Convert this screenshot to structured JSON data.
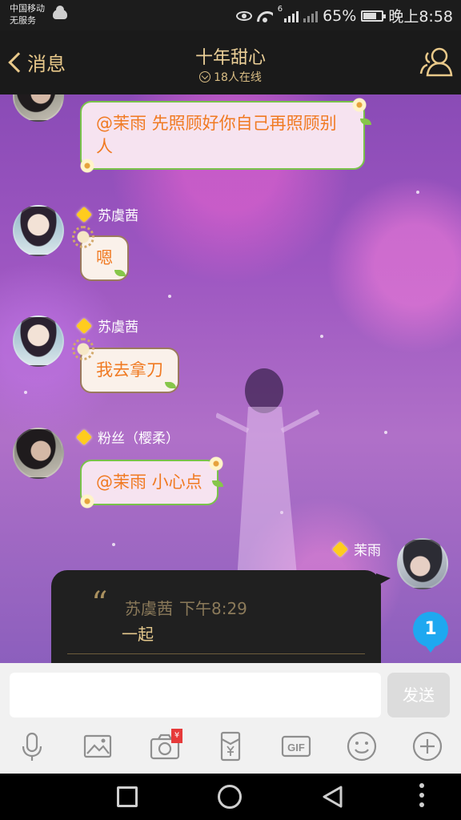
{
  "status_bar": {
    "carrier_line1": "中国移动",
    "carrier_line2": "无服务",
    "network_type": "6",
    "battery": "65%",
    "time": "晚上8:58"
  },
  "header": {
    "back_label": "消息",
    "title": "十年甜心",
    "online_count": "18人在线"
  },
  "messages": [
    {
      "sender": "",
      "text": "@茉雨 先照顾好你自己再照顾别人",
      "style": "green"
    },
    {
      "sender": "苏虞茜",
      "text": "嗯",
      "style": "brown"
    },
    {
      "sender": "苏虞茜",
      "text": "我去拿刀",
      "style": "brown"
    },
    {
      "sender": "粉丝（樱柔）",
      "text": "@茉雨 小心点",
      "style": "green"
    },
    {
      "sender": "茉雨",
      "self": true
    }
  ],
  "reply": {
    "quote_mark": "“",
    "quoted_sender": "苏虞茜",
    "quoted_time": "下午8:29",
    "quoted_text": "一起"
  },
  "unread_badge": "1",
  "composer": {
    "input_value": "",
    "input_placeholder": "",
    "send_label": "发送"
  },
  "toolbar": {
    "items": [
      "microphone-icon",
      "image-icon",
      "camera-icon",
      "red-envelope-icon",
      "gif-icon",
      "emoji-icon",
      "plus-icon"
    ],
    "camera_badge": "¥",
    "gif_label": "GIF"
  },
  "colors": {
    "header_bg": "#1a1a1a",
    "header_text": "#ecd098",
    "bubble_text": "#f07a22",
    "badge": "#1ea8f0"
  }
}
